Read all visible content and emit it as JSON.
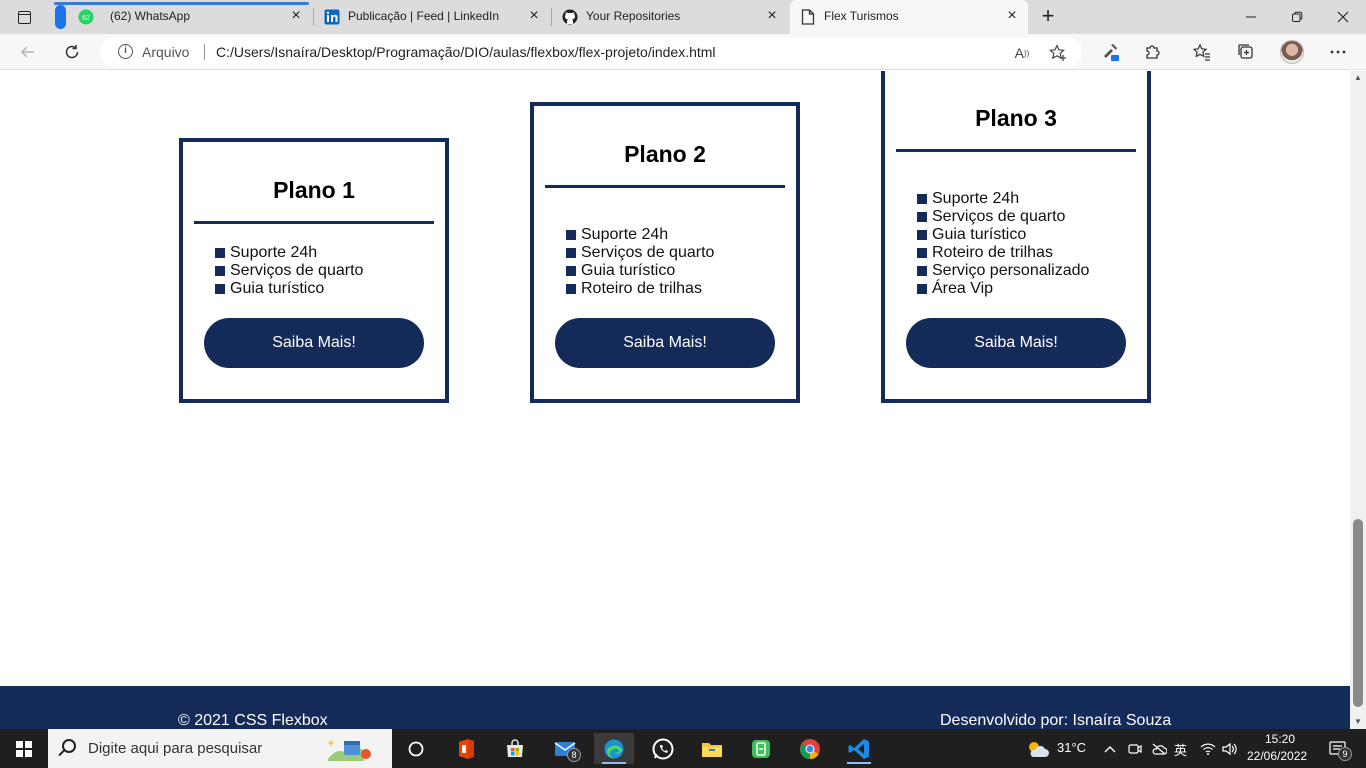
{
  "browser": {
    "tabs": [
      {
        "title": "(62) WhatsApp",
        "badge": "62",
        "icon": "whatsapp-icon"
      },
      {
        "title": "Publicação | Feed | LinkedIn",
        "icon": "linkedin-icon"
      },
      {
        "title": "Your Repositories",
        "icon": "github-icon"
      },
      {
        "title": "Flex Turismos",
        "icon": "page-icon",
        "active": true
      }
    ],
    "address": {
      "scheme_label": "Arquivo",
      "url": "C:/Users/Isnaíra/Desktop/Programação/DIO/aulas/flexbox/flex-projeto/index.html"
    },
    "read_aloud_glyph": "A"
  },
  "page": {
    "plans": [
      {
        "title": "Plano 1",
        "features": [
          "Suporte 24h",
          "Serviços de quarto",
          "Guia turístico"
        ],
        "button": "Saiba Mais!"
      },
      {
        "title": "Plano 2",
        "features": [
          "Suporte 24h",
          "Serviços de quarto",
          "Guia turístico",
          "Roteiro de trilhas"
        ],
        "button": "Saiba Mais!"
      },
      {
        "title": "Plano 3",
        "features": [
          "Suporte 24h",
          "Serviços de quarto",
          "Guia turístico",
          "Roteiro de trilhas",
          "Serviço personalizado",
          "Área Vip"
        ],
        "button": "Saiba Mais!"
      }
    ],
    "footer": {
      "left": "© 2021 CSS Flexbox",
      "right": "Desenvolvido por: Isnaíra Souza"
    },
    "colors": {
      "brand": "#142b5a"
    }
  },
  "taskbar": {
    "search_placeholder": "Digite aqui para pesquisar",
    "mail_badge": "8",
    "weather": "31°C",
    "input_lang": "英",
    "time": "15:20",
    "date": "22/06/2022",
    "notifications": "9"
  }
}
